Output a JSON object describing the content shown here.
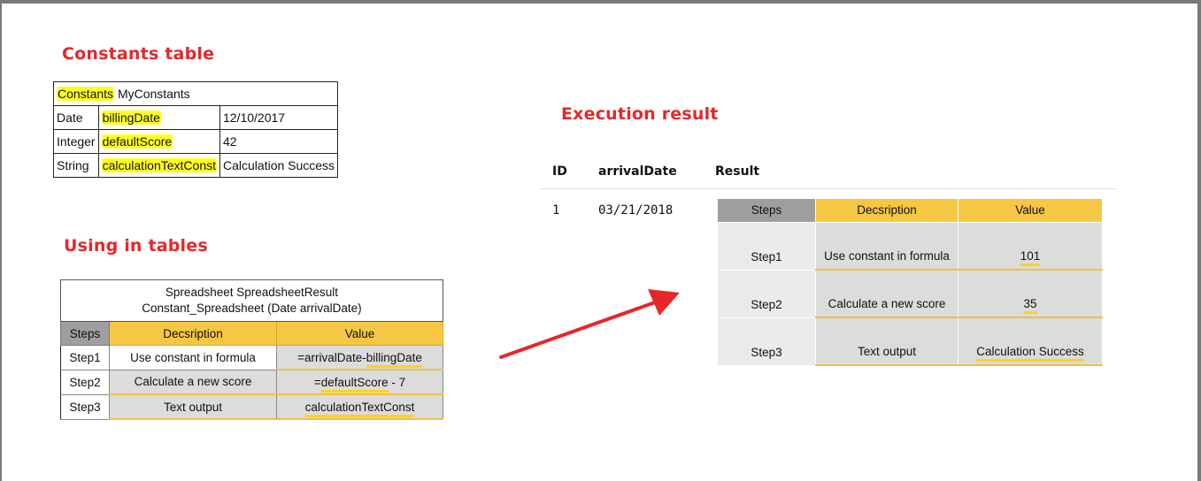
{
  "headings": {
    "constants": "Constants table",
    "using": "Using in tables",
    "execution": "Execution result"
  },
  "constants_table": {
    "keyword": "Constants",
    "name": "MyConstants",
    "rows": [
      {
        "type": "Date",
        "name": "billingDate",
        "value": "12/10/2017"
      },
      {
        "type": "Integer",
        "name": "defaultScore",
        "value": "42"
      },
      {
        "type": "String",
        "name": "calculationTextConst",
        "value": "Calculation Success"
      }
    ]
  },
  "spreadsheet": {
    "title_line1": "Spreadsheet SpreadsheetResult",
    "title_line2": "Constant_Spreadsheet (Date arrivalDate)",
    "headers": {
      "steps": "Steps",
      "description": "Decsription",
      "value": "Value"
    },
    "rows": [
      {
        "step": "Step1",
        "description": "Use constant in formula",
        "value_prefix": "=arrivalDate-",
        "value_hl": "billingDate",
        "value_suffix": ""
      },
      {
        "step": "Step2",
        "description": "Calculate a new score",
        "value_prefix": "=",
        "value_hl": "defaultScore",
        "value_suffix": " - 7"
      },
      {
        "step": "Step3",
        "description": "Text output",
        "value_prefix": "",
        "value_hl": "calculationTextConst",
        "value_suffix": ""
      }
    ]
  },
  "execution": {
    "columns": {
      "id": "ID",
      "arrival": "arrivalDate",
      "result": "Result"
    },
    "row": {
      "id": "1",
      "arrival": "03/21/2018"
    },
    "result_table": {
      "headers": {
        "steps": "Steps",
        "description": "Decsription",
        "value": "Value"
      },
      "rows": [
        {
          "step": "Step1",
          "description": "Use constant in formula",
          "value": "101"
        },
        {
          "step": "Step2",
          "description": "Calculate a new score",
          "value": "35"
        },
        {
          "step": "Step3",
          "description": "Text output",
          "value": "Calculation Success"
        }
      ]
    }
  },
  "colors": {
    "heading": "#e8262a",
    "highlight": "#ffff20",
    "header_gold": "#f5c744",
    "header_gray": "#9e9e9e",
    "arrow": "#e8262a"
  },
  "icons": {
    "arrow": "red-arrow-icon"
  }
}
